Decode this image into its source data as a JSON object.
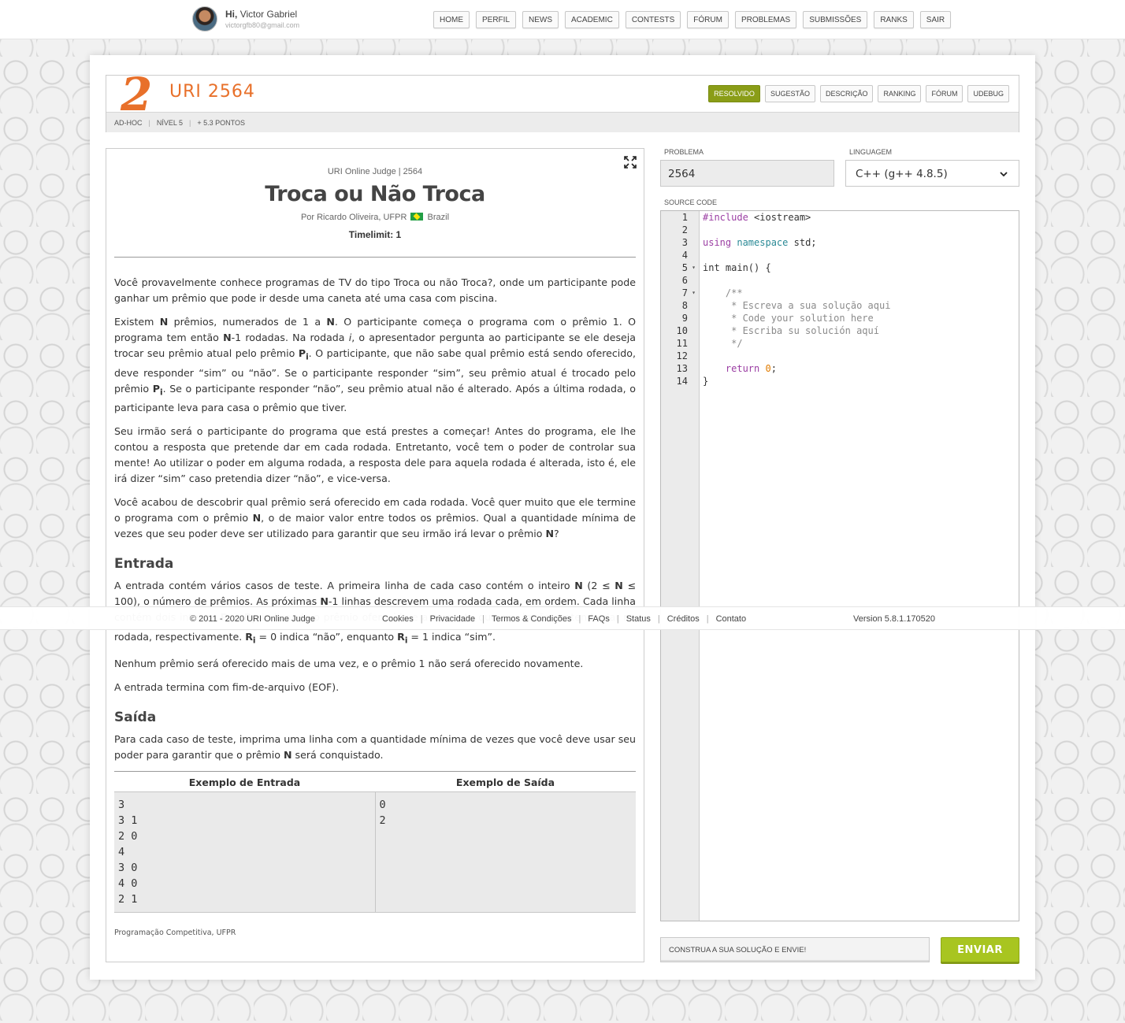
{
  "user": {
    "greeting_prefix": "Hi,",
    "name": "Victor Gabriel",
    "email": "victorgfb80@gmail.com"
  },
  "topnav": [
    "HOME",
    "PERFIL",
    "NEWS",
    "ACADEMIC",
    "CONTESTS",
    "FÓRUM",
    "PROBLEMAS",
    "SUBMISSÕES",
    "RANKS",
    "SAIR"
  ],
  "problem_header": {
    "logo_digit": "2",
    "code": "URI 2564",
    "category": "AD-HOC",
    "level": "NÍVEL 5",
    "points": "+ 5.3 PONTOS",
    "tabs": [
      {
        "label": "RESOLVIDO",
        "active": true
      },
      {
        "label": "SUGESTÃO",
        "active": false
      },
      {
        "label": "DESCRIÇÃO",
        "active": false
      },
      {
        "label": "RANKING",
        "active": false
      },
      {
        "label": "FÓRUM",
        "active": false
      },
      {
        "label": "UDEBUG",
        "active": false
      }
    ]
  },
  "description": {
    "meta": "URI Online Judge | 2564",
    "title": "Troca ou Não Troca",
    "author": "Por Ricardo Oliveira, UFPR",
    "country": "Brazil",
    "timelimit": "Timelimit: 1",
    "paragraphs": [
      "Você provavelmente conhece programas de TV do tipo Troca ou não Troca?, onde um participante pode ganhar um prêmio que pode ir desde uma caneta até uma casa com piscina.",
      "Existem N prêmios, numerados de 1 a N. O participante começa o programa com o prêmio 1. O programa tem então N-1 rodadas. Na rodada i, o apresentador pergunta ao participante se ele deseja trocar seu prêmio atual pelo prêmio Pi. O participante, que não sabe qual prêmio está sendo oferecido, deve responder “sim” ou “não”. Se o participante responder “sim”, seu prêmio atual é trocado pelo prêmio Pi. Se o participante responder “não”, seu prêmio atual não é alterado. Após a última rodada, o participante leva para casa o prêmio que tiver.",
      "Seu irmão será o participante do programa que está prestes a começar! Antes do programa, ele lhe contou a resposta que pretende dar em cada rodada. Entretanto, você tem o poder de controlar sua mente! Ao utilizar o poder em alguma rodada, a resposta dele para aquela rodada é alterada, isto é, ele irá dizer “sim” caso pretendia dizer “não”, e vice-versa.",
      "Você acabou de descobrir qual prêmio será oferecido em cada rodada. Você quer muito que ele termine o programa com o prêmio N, o de maior valor entre todos os prêmios. Qual a quantidade mínima de vezes que seu poder deve ser utilizado para garantir que seu irmão irá levar o prêmio N?"
    ],
    "input_title": "Entrada",
    "input_paragraphs": [
      "A entrada contém vários casos de teste. A primeira linha de cada caso contém o inteiro N (2 ≤ N ≤ 100), o número de prêmios. As próximas N-1 linhas descrevem uma rodada cada, em ordem. Cada linha contém dois inteiros Pi e Ri, indicando o prêmio oferecido e a resposta que seu irmão pretende dar na rodada, respectivamente. Ri = 0 indica “não”, enquanto Ri = 1 indica “sim”.",
      "Nenhum prêmio será oferecido mais de uma vez, e o prêmio 1 não será oferecido novamente.",
      "A entrada termina com fim-de-arquivo (EOF)."
    ],
    "output_title": "Saída",
    "output_paragraph": "Para cada caso de teste, imprima uma linha com a quantidade mínima de vezes que você deve usar seu poder para garantir que o prêmio N será conquistado.",
    "sample_input_title": "Exemplo de Entrada",
    "sample_output_title": "Exemplo de Saída",
    "sample_input": "3\n3 1\n2 0\n4\n3 0\n4 0\n2 1",
    "sample_output": "0\n2",
    "source": "Programação Competitiva, UFPR"
  },
  "editor": {
    "problem_label": "PROBLEMA",
    "problem_value": "2564",
    "language_label": "LINGUAGEM",
    "language_value": "C++ (g++ 4.8.5)",
    "source_label": "SOURCE CODE",
    "line_count": 14,
    "fold_lines": [
      5,
      7
    ],
    "submit_hint": "CONSTRUA A SUA SOLUÇÃO E ENVIE!",
    "submit_label": "ENVIAR"
  },
  "footer": {
    "copyright": "© 2011 - 2020 URI Online Judge",
    "links": [
      "Cookies",
      "Privacidade",
      "Termos & Condições",
      "FAQs",
      "Status",
      "Créditos",
      "Contato"
    ],
    "version": "Version 5.8.1.170520"
  },
  "colors": {
    "accent_orange": "#e8702a",
    "resolved_green": "#8a9d17",
    "submit_green": "#a8c520"
  }
}
